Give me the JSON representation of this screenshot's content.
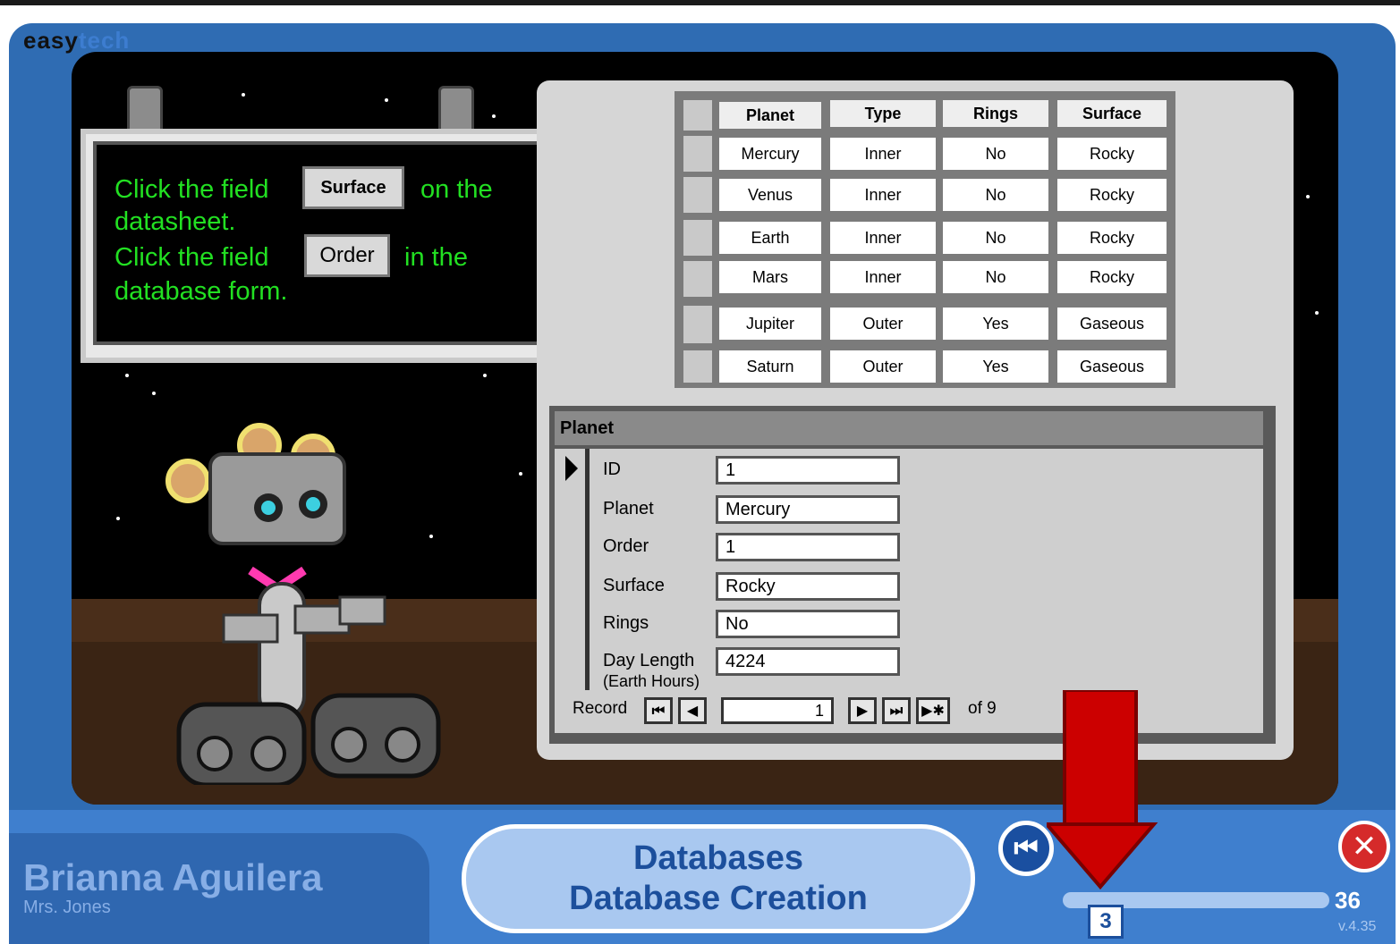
{
  "brand": {
    "part1": "easy",
    "part2": "tech"
  },
  "instructions": {
    "line1_pre": "Click the field",
    "line1_field": "Surface",
    "line1_post": "on the",
    "line2": "datasheet.",
    "line3_pre": "Click the field",
    "line3_field": "Order",
    "line3_post": "in the",
    "line4": "database form."
  },
  "datasheet": {
    "headers": [
      "Planet",
      "Type",
      "Rings",
      "Surface"
    ],
    "rows": [
      [
        "Mercury",
        "Inner",
        "No",
        "Rocky"
      ],
      [
        "Venus",
        "Inner",
        "No",
        "Rocky"
      ],
      [
        "Earth",
        "Inner",
        "No",
        "Rocky"
      ],
      [
        "Mars",
        "Inner",
        "No",
        "Rocky"
      ],
      [
        "Jupiter",
        "Outer",
        "Yes",
        "Gaseous"
      ],
      [
        "Saturn",
        "Outer",
        "Yes",
        "Gaseous"
      ]
    ]
  },
  "form": {
    "title": "Planet",
    "fields": [
      {
        "label": "ID",
        "value": "1"
      },
      {
        "label": "Planet",
        "value": "Mercury"
      },
      {
        "label": "Order",
        "value": "1"
      },
      {
        "label": "Surface",
        "value": "Rocky"
      },
      {
        "label": "Rings",
        "value": "No"
      },
      {
        "label": "Day Length",
        "value": "4224"
      }
    ],
    "day_length_sub": "(Earth Hours)",
    "record_label": "Record",
    "record_value": "1",
    "record_of": "of 9"
  },
  "footer": {
    "student": "Brianna Aguilera",
    "teacher": "Mrs. Jones",
    "course": "Databases",
    "lesson": "Database Creation",
    "current_page": "3",
    "total_pages": "36",
    "version": "v.4.35"
  },
  "colors": {
    "accent": "#2f6cb3",
    "instruction_text": "#22e022",
    "arrow": "#cc0000"
  },
  "icons": [
    "back-icon",
    "close-icon",
    "first-record-icon",
    "prev-record-icon",
    "next-record-icon",
    "last-record-icon",
    "new-record-icon",
    "record-pointer-icon",
    "down-arrow-icon"
  ]
}
